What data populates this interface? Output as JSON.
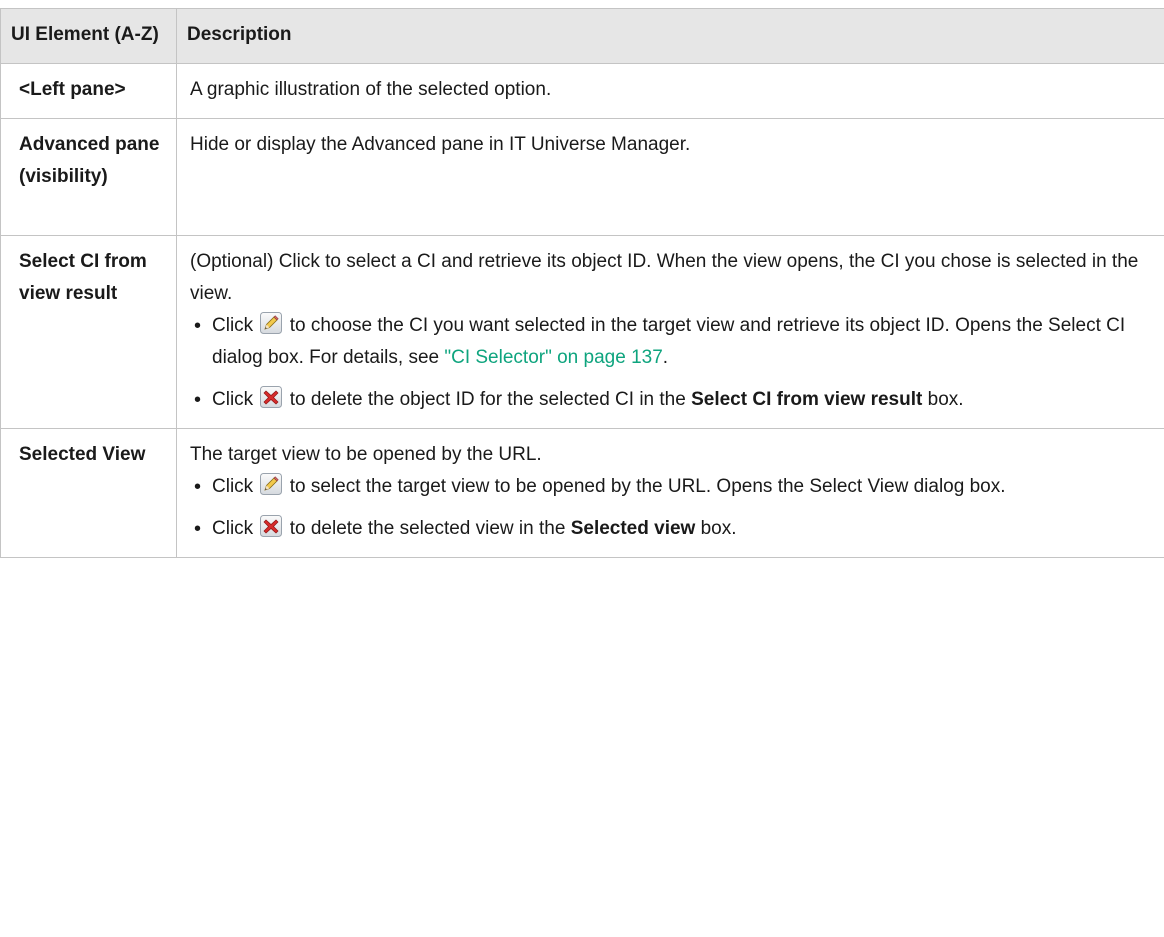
{
  "header": {
    "col1": "UI Element (A-Z)",
    "col2": "Description"
  },
  "rows": {
    "left_pane": {
      "element": "<Left pane>",
      "description": "A graphic illustration of the selected option."
    },
    "advanced_pane": {
      "element": "Advanced pane (visibility)",
      "description": "Hide or display the Advanced pane in IT Universe Manager."
    },
    "select_ci": {
      "element": "Select CI from view result",
      "description": "(Optional) Click to select a CI and retrieve its object ID. When the view opens, the CI you chose is selected in the view.",
      "bullet1": {
        "prefix": "Click",
        "icon": "edit-pencil-icon",
        "text": "to choose the CI you want selected in the target view and retrieve its object ID. Opens the Select CI dialog box. For details, see",
        "link": "\"CI Selector\" on page 137",
        "suffix": "."
      },
      "bullet2": {
        "prefix": "Click",
        "icon": "delete-x-icon",
        "text": "to delete the object ID for the selected CI in the",
        "bold": "Select CI from view result",
        "suffix": "box."
      }
    },
    "selected_view": {
      "element": "Selected View",
      "description": "The target view to be opened by the URL.",
      "bullet1": {
        "prefix": "Click",
        "icon": "edit-pencil-icon",
        "text": "to select the target view to be opened by the URL. Opens the Select View dialog box."
      },
      "bullet2": {
        "prefix": "Click",
        "icon": "delete-x-icon",
        "text": "to delete the selected view in the",
        "bold": "Selected view",
        "suffix": "box."
      }
    }
  },
  "colors": {
    "link": "#0ea47e",
    "header_bg": "#e6e6e6",
    "border": "#c4c4c4",
    "delete_icon": "#cc2222"
  }
}
